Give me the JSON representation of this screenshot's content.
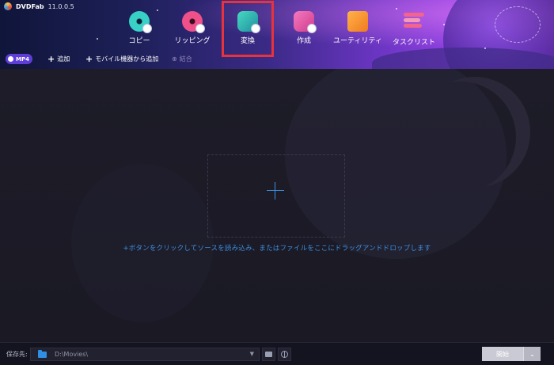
{
  "app": {
    "name": "DVDFab",
    "version": "11.0.0.5"
  },
  "nav": {
    "items": [
      {
        "label": "コピー",
        "icon": "disc-copy-icon"
      },
      {
        "label": "リッピング",
        "icon": "disc-ripper-icon"
      },
      {
        "label": "変換",
        "icon": "converter-icon",
        "selected": true
      },
      {
        "label": "作成",
        "icon": "creator-icon"
      },
      {
        "label": "ユーティリティ",
        "icon": "utility-folder-icon"
      },
      {
        "label": "タスクリスト",
        "icon": "task-list-icon"
      }
    ]
  },
  "toolbar": {
    "profile_label": "MP4",
    "add_label": "追加",
    "add_mobile_label": "モバイル機器から追加",
    "merge_label": "結合"
  },
  "main": {
    "hint": "+ボタンをクリックしてソースを読み込み、またはファイルをここにドラッグアンドドロップします"
  },
  "footer": {
    "save_to_label": "保存先:",
    "path_value": "D:\\Movies\\",
    "start_label": "開始"
  },
  "colors": {
    "accent": "#3d8fe0",
    "highlight": "#e8323c",
    "profile_pill": "#5f3dd8"
  }
}
